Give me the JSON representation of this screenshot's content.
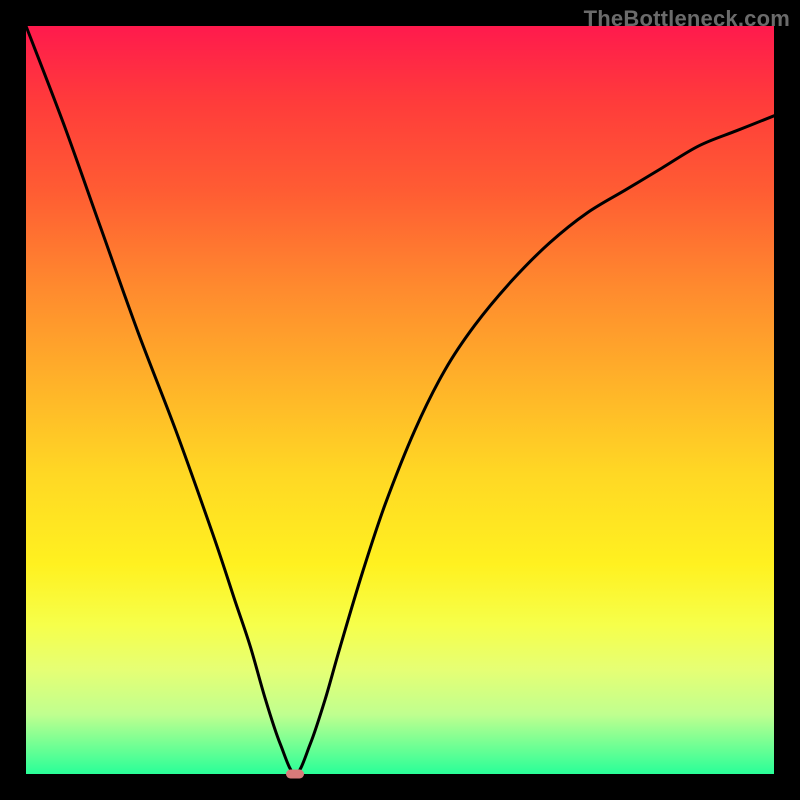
{
  "watermark": "TheBottleneck.com",
  "colors": {
    "border": "#000000",
    "curve": "#000000",
    "marker": "#d77a7a",
    "gradient_top": "#ff1a4d",
    "gradient_bottom": "#29ff98"
  },
  "chart_data": {
    "type": "line",
    "title": "",
    "xlabel": "",
    "ylabel": "",
    "xlim": [
      0,
      100
    ],
    "ylim": [
      0,
      100
    ],
    "series": [
      {
        "name": "bottleneck-curve",
        "x": [
          0,
          5,
          10,
          15,
          20,
          25,
          28,
          30,
          32,
          34,
          36,
          38,
          40,
          42,
          45,
          48,
          52,
          56,
          60,
          65,
          70,
          75,
          80,
          85,
          90,
          95,
          100
        ],
        "y": [
          100,
          87,
          73,
          59,
          46,
          32,
          23,
          17,
          10,
          4,
          0,
          4,
          10,
          17,
          27,
          36,
          46,
          54,
          60,
          66,
          71,
          75,
          78,
          81,
          84,
          86,
          88
        ]
      }
    ],
    "annotations": [
      {
        "name": "optimal-marker",
        "x": 36,
        "y": 0
      }
    ]
  }
}
